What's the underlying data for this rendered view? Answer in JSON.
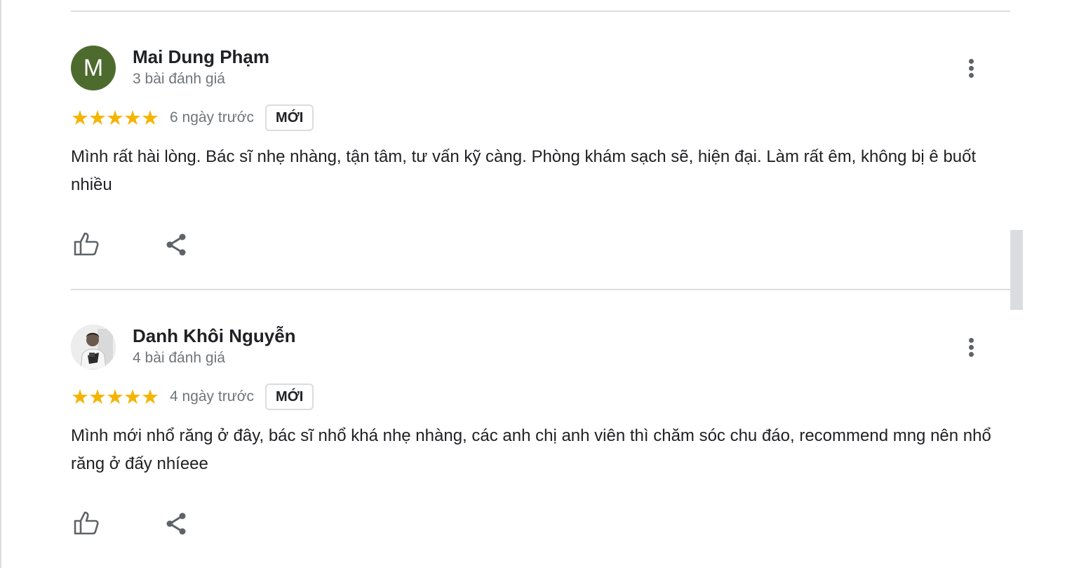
{
  "reviews": [
    {
      "avatar_letter": "M",
      "avatar_color": "#4d6b2d",
      "author": "Mai Dung Phạm",
      "review_count": "3 bài đánh giá",
      "stars": "★★★★★",
      "rating": 5,
      "date": "6 ngày trước",
      "badge": "MỚI",
      "text": "Mình rất hài lòng. Bác sĩ nhẹ nhàng, tận tâm, tư vấn kỹ càng. Phòng khám sạch sẽ, hiện đại. Làm rất êm, không bị ê buốt nhiều"
    },
    {
      "avatar_letter": "",
      "author": "Danh Khôi Nguyễn",
      "review_count": "4 bài đánh giá",
      "stars": "★★★★★",
      "rating": 5,
      "date": "4 ngày trước",
      "badge": "MỚI",
      "text": "Mình mới nhổ răng ở đây, bác sĩ nhổ khá nhẹ nhàng, các anh chị anh viên thì chăm sóc chu đáo, recommend mng nên nhổ răng ở đấy nhíeee"
    }
  ],
  "icons": {
    "like": "thumb-up-icon",
    "share": "share-icon",
    "more": "more-vert-icon"
  },
  "colors": {
    "star": "#f4b400",
    "divider": "#dadce0",
    "secondary_text": "#70757a"
  }
}
